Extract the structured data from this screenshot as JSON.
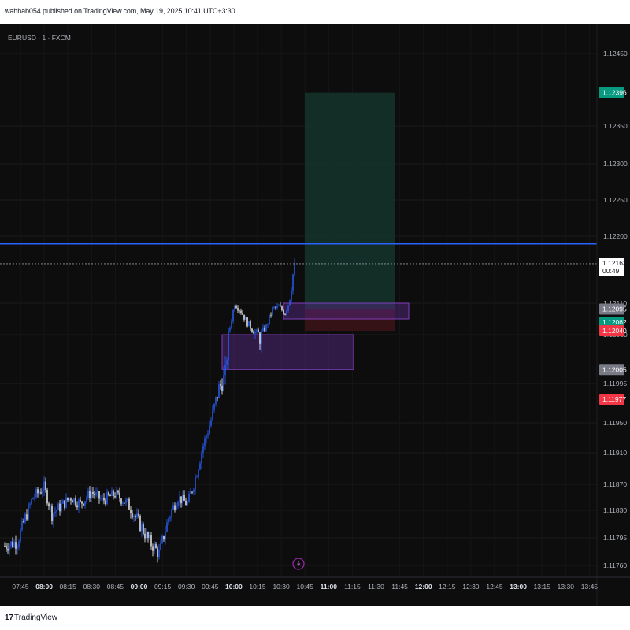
{
  "header": {
    "publish_text": "wahhab054 published on TradingView.com, May 19, 2025 10:41 UTC+3:30"
  },
  "footer": {
    "logo": "17",
    "brand": "TradingView"
  },
  "symbol_label": "EURUSD · 1 · FXCM",
  "colors": {
    "up": "#2962ff",
    "down": "#ffffff",
    "hline": "#2962ff",
    "tp_zone": "#14322a",
    "sl_zone": "#3a1316",
    "box": "#4a1a7a",
    "green_tag": "#089981",
    "red_tag": "#f23645",
    "gray_tag": "#787b86"
  },
  "chart_data": {
    "type": "candlestick",
    "y_ticks": [
      "1.12450",
      "1.12350",
      "1.12300",
      "1.12250",
      "1.12200",
      "1.12110",
      "1.12030",
      "1.11995",
      "1.11950",
      "1.11910",
      "1.11870",
      "1.11830",
      "1.11795",
      "1.11760"
    ],
    "x_ticks": [
      "07:45",
      "08:00",
      "08:15",
      "08:30",
      "08:45",
      "09:00",
      "09:15",
      "09:30",
      "09:45",
      "10:00",
      "10:15",
      "10:30",
      "10:45",
      "11:00",
      "11:15",
      "11:30",
      "11:45",
      "12:00",
      "12:15",
      "12:30",
      "12:45",
      "13:00",
      "13:15",
      "13:30",
      "13:45"
    ],
    "bold_x_ticks": [
      "08:00",
      "09:00",
      "10:00",
      "11:00",
      "12:00",
      "13:00"
    ],
    "horizontal_line": 1.1219,
    "current_price": {
      "value": "1.12163",
      "countdown": "00:49"
    },
    "price_tags": [
      {
        "value": "1.12396",
        "style": "green"
      },
      {
        "value": "1.12095",
        "style": "gray"
      },
      {
        "value": "1.12062",
        "style": "green"
      },
      {
        "value": "1.12040",
        "style": "red"
      },
      {
        "value": "1.12005",
        "style": "gray"
      },
      {
        "value": "1.11977",
        "style": "red"
      }
    ],
    "position": {
      "entry": 1.12095,
      "take_profit": 1.12396,
      "stop_loss": 1.1204
    },
    "zones": [
      {
        "top": 1.1211,
        "bottom": 1.1207
      },
      {
        "top": 1.1203,
        "bottom": 1.12005
      }
    ]
  }
}
